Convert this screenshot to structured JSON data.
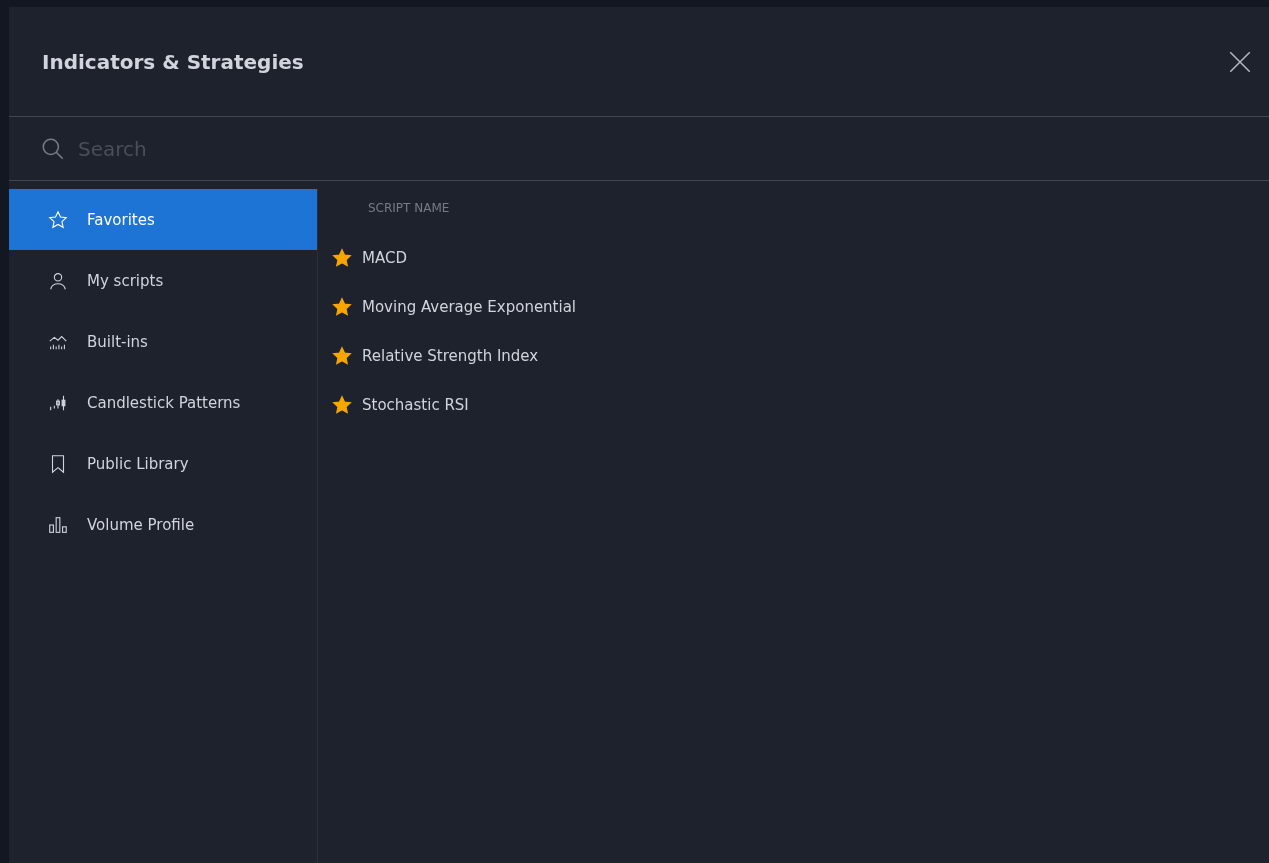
{
  "dialog": {
    "title": "Indicators & Strategies"
  },
  "search": {
    "placeholder": "Search"
  },
  "sidebar": {
    "items": [
      {
        "label": "Favorites",
        "selected": true
      },
      {
        "label": "My scripts",
        "selected": false
      },
      {
        "label": "Built-ins",
        "selected": false
      },
      {
        "label": "Candlestick Patterns",
        "selected": false
      },
      {
        "label": "Public Library",
        "selected": false
      },
      {
        "label": "Volume Profile",
        "selected": false
      }
    ]
  },
  "list": {
    "column_header": "SCRIPT NAME",
    "rows": [
      {
        "name": "MACD",
        "favorite": true
      },
      {
        "name": "Moving Average Exponential",
        "favorite": true
      },
      {
        "name": "Relative Strength Index",
        "favorite": true
      },
      {
        "name": "Stochastic RSI",
        "favorite": true
      }
    ]
  }
}
